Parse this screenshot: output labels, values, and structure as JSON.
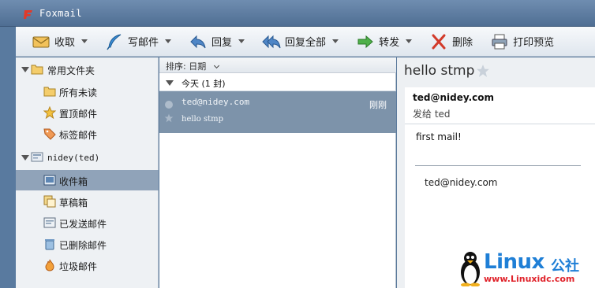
{
  "window": {
    "title": "Foxmail"
  },
  "toolbar": {
    "receive": "收取",
    "compose": "写邮件",
    "reply": "回复",
    "reply_all": "回复全部",
    "forward": "转发",
    "delete": "删除",
    "print_preview": "打印预览"
  },
  "sidebar": {
    "favorites_header": "常用文件夹",
    "favorites": [
      "所有未读",
      "置顶邮件",
      "标签邮件"
    ],
    "account": "nidey(ted)",
    "folders": [
      "收件箱",
      "草稿箱",
      "已发送邮件",
      "已删除邮件",
      "垃圾邮件"
    ],
    "selected": "收件箱"
  },
  "list": {
    "sort_label": "排序: 日期",
    "group_label": "今天 (1 封)",
    "items": [
      {
        "from": "ted@nidey.com",
        "time": "刚刚",
        "subject": "hello stmp"
      }
    ]
  },
  "reader": {
    "subject": "hello stmp",
    "from": "ted@nidey.com",
    "to": "发给 ted",
    "body": "first mail!",
    "signature": "ted@nidey.com"
  },
  "watermark": {
    "word": "Linux",
    "cn": "公社",
    "url": "www.Linuxidc.com"
  },
  "colors": {
    "titlebar": "#5b7a9c",
    "selected_row": "#90a3b9",
    "selected_mail": "#7d93aa",
    "watermark_blue": "#1f7fd6",
    "watermark_red": "#e0232b"
  }
}
